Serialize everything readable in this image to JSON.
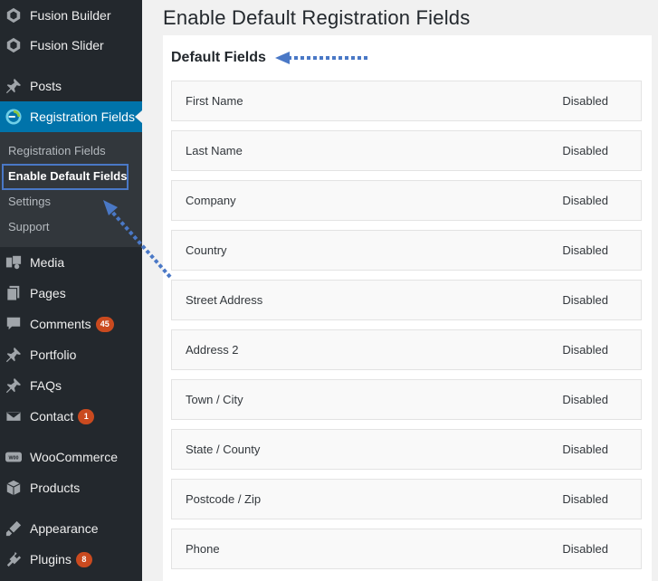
{
  "sidebar": {
    "items": [
      {
        "label": "Fusion Builder",
        "icon": "fusion-builder-icon"
      },
      {
        "label": "Fusion Slider",
        "icon": "fusion-slider-icon"
      },
      {
        "label": "Posts",
        "icon": "pin-icon"
      },
      {
        "label": "Registration Fields",
        "icon": "registration-fields-icon"
      },
      {
        "label": "Media",
        "icon": "media-icon"
      },
      {
        "label": "Pages",
        "icon": "pages-icon"
      },
      {
        "label": "Comments",
        "icon": "comments-icon",
        "badge": "45"
      },
      {
        "label": "Portfolio",
        "icon": "pin-icon"
      },
      {
        "label": "FAQs",
        "icon": "pin-icon"
      },
      {
        "label": "Contact",
        "icon": "mail-icon",
        "badge": "1"
      },
      {
        "label": "WooCommerce",
        "icon": "woocommerce-icon"
      },
      {
        "label": "Products",
        "icon": "products-icon"
      },
      {
        "label": "Appearance",
        "icon": "appearance-icon"
      },
      {
        "label": "Plugins",
        "icon": "plugins-icon",
        "badge": "8"
      }
    ],
    "submenu": [
      {
        "label": "Registration Fields"
      },
      {
        "label": "Enable Default Fields"
      },
      {
        "label": "Settings"
      },
      {
        "label": "Support"
      }
    ]
  },
  "main": {
    "title": "Enable Default Registration Fields",
    "section_title": "Default Fields",
    "fields": [
      {
        "name": "First Name",
        "status": "Disabled"
      },
      {
        "name": "Last Name",
        "status": "Disabled"
      },
      {
        "name": "Company",
        "status": "Disabled"
      },
      {
        "name": "Country",
        "status": "Disabled"
      },
      {
        "name": "Street Address",
        "status": "Disabled"
      },
      {
        "name": "Address 2",
        "status": "Disabled"
      },
      {
        "name": "Town / City",
        "status": "Disabled"
      },
      {
        "name": "State / County",
        "status": "Disabled"
      },
      {
        "name": "Postcode / Zip",
        "status": "Disabled"
      },
      {
        "name": "Phone",
        "status": "Disabled"
      }
    ]
  },
  "colors": {
    "sidebar_bg": "#23282d",
    "submenu_bg": "#32373c",
    "accent": "#0073aa",
    "badge": "#ca4a1f",
    "annotation": "#4a78c6"
  }
}
